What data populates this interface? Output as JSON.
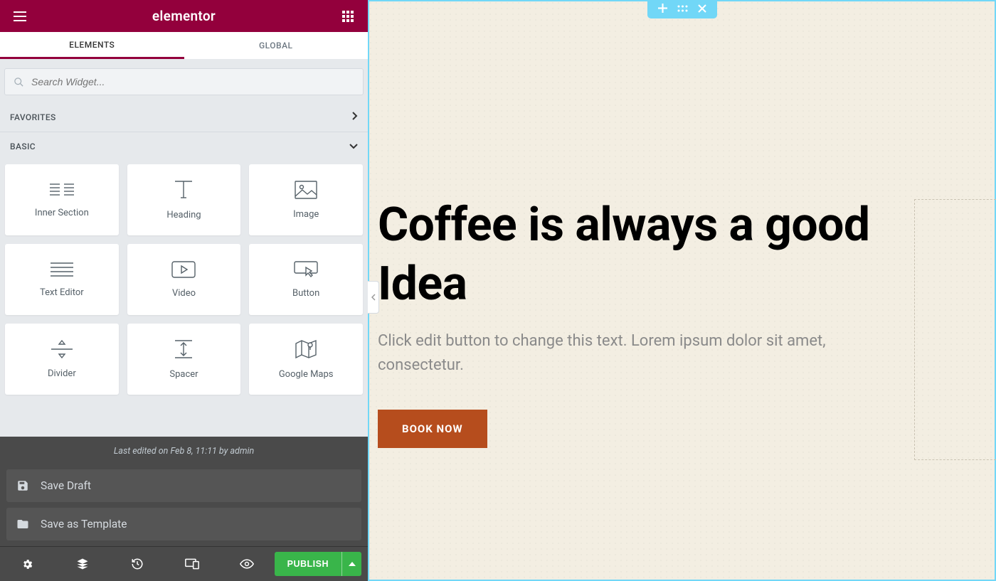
{
  "header": {
    "logo": "elementor"
  },
  "tabs": {
    "elements": "ELEMENTS",
    "global": "GLOBAL"
  },
  "search": {
    "placeholder": "Search Widget..."
  },
  "sections": {
    "favorites": "FAVORITES",
    "basic": "BASIC"
  },
  "widgets": [
    {
      "name": "Inner Section",
      "id": "inner-section"
    },
    {
      "name": "Heading",
      "id": "heading"
    },
    {
      "name": "Image",
      "id": "image"
    },
    {
      "name": "Text Editor",
      "id": "text-editor"
    },
    {
      "name": "Video",
      "id": "video"
    },
    {
      "name": "Button",
      "id": "button"
    },
    {
      "name": "Divider",
      "id": "divider"
    },
    {
      "name": "Spacer",
      "id": "spacer"
    },
    {
      "name": "Google Maps",
      "id": "google-maps"
    }
  ],
  "flyout": {
    "meta": "Last edited on Feb 8, 11:11 by admin",
    "save_draft": "Save Draft",
    "save_template": "Save as Template"
  },
  "bottombar": {
    "publish": "PUBLISH"
  },
  "hero": {
    "heading": "Coffee is always a good Idea",
    "text": "Click edit button to change this text. Lorem ipsum dolor sit amet, consectetur.",
    "cta": "BOOK NOW"
  }
}
